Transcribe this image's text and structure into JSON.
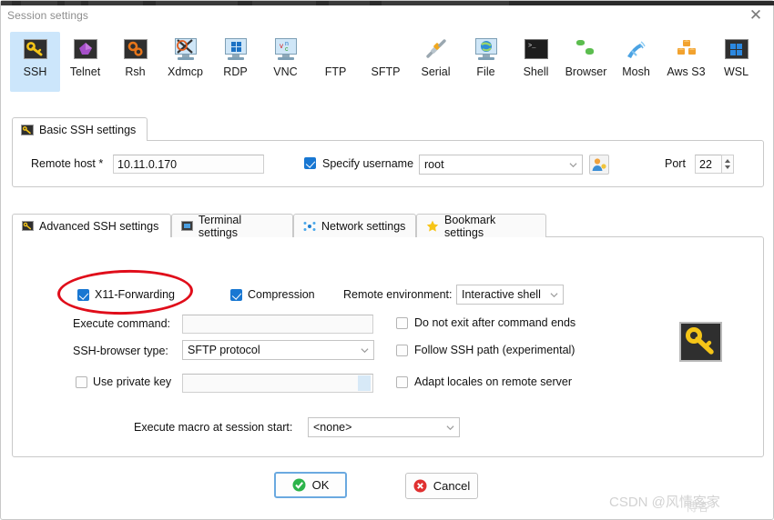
{
  "window": {
    "title": "Session settings",
    "close_label": "✕"
  },
  "protocols": [
    {
      "label": "SSH",
      "icon": "ssh-key-icon",
      "selected": true
    },
    {
      "label": "Telnet",
      "icon": "telnet-icon",
      "selected": false
    },
    {
      "label": "Rsh",
      "icon": "rsh-gears-icon",
      "selected": false
    },
    {
      "label": "Xdmcp",
      "icon": "xdmcp-icon",
      "selected": false
    },
    {
      "label": "RDP",
      "icon": "rdp-windows-icon",
      "selected": false
    },
    {
      "label": "VNC",
      "icon": "vnc-icon",
      "selected": false
    },
    {
      "label": "FTP",
      "icon": "ftp-globe-icon",
      "selected": false
    },
    {
      "label": "SFTP",
      "icon": "sftp-globe-icon",
      "selected": false
    },
    {
      "label": "Serial",
      "icon": "serial-plug-icon",
      "selected": false
    },
    {
      "label": "File",
      "icon": "file-monitor-icon",
      "selected": false
    },
    {
      "label": "Shell",
      "icon": "shell-terminal-icon",
      "selected": false
    },
    {
      "label": "Browser",
      "icon": "browser-globe-icon",
      "selected": false
    },
    {
      "label": "Mosh",
      "icon": "mosh-satellite-icon",
      "selected": false
    },
    {
      "label": "Aws S3",
      "icon": "aws-s3-icon",
      "selected": false
    },
    {
      "label": "WSL",
      "icon": "wsl-windows-icon",
      "selected": false
    }
  ],
  "basic": {
    "tab_label": "Basic SSH settings",
    "remote_host_label": "Remote host *",
    "remote_host_value": "10.11.0.170",
    "specify_username_label": "Specify username",
    "specify_username_checked": true,
    "username_value": "root",
    "port_label": "Port",
    "port_value": "22"
  },
  "tabs": [
    {
      "label": "Advanced SSH settings",
      "icon": "ssh-key-icon",
      "active": true
    },
    {
      "label": "Terminal settings",
      "icon": "terminal-icon",
      "active": false
    },
    {
      "label": "Network settings",
      "icon": "network-dots-icon",
      "active": false
    },
    {
      "label": "Bookmark settings",
      "icon": "star-icon",
      "active": false
    }
  ],
  "advanced": {
    "x11_label": "X11-Forwarding",
    "x11_checked": true,
    "compression_label": "Compression",
    "compression_checked": true,
    "remote_env_label": "Remote environment:",
    "remote_env_value": "Interactive shell",
    "execute_command_label": "Execute command:",
    "execute_command_value": "",
    "no_exit_label": "Do not exit after command ends",
    "no_exit_checked": false,
    "ssh_browser_label": "SSH-browser type:",
    "ssh_browser_value": "SFTP protocol",
    "follow_path_label": "Follow SSH path (experimental)",
    "follow_path_checked": false,
    "private_key_label": "Use private key",
    "private_key_checked": false,
    "private_key_value": "",
    "adapt_locales_label": "Adapt locales on remote server",
    "adapt_locales_checked": false,
    "macro_label": "Execute macro at session start:",
    "macro_value": "<none>"
  },
  "footer": {
    "ok_label": "OK",
    "cancel_label": "Cancel"
  },
  "annotation": {
    "color": "#e00d1a",
    "target": "X11-Forwarding"
  },
  "watermark": {
    "text": "CSDN @风情客家",
    "text2": "博客"
  }
}
